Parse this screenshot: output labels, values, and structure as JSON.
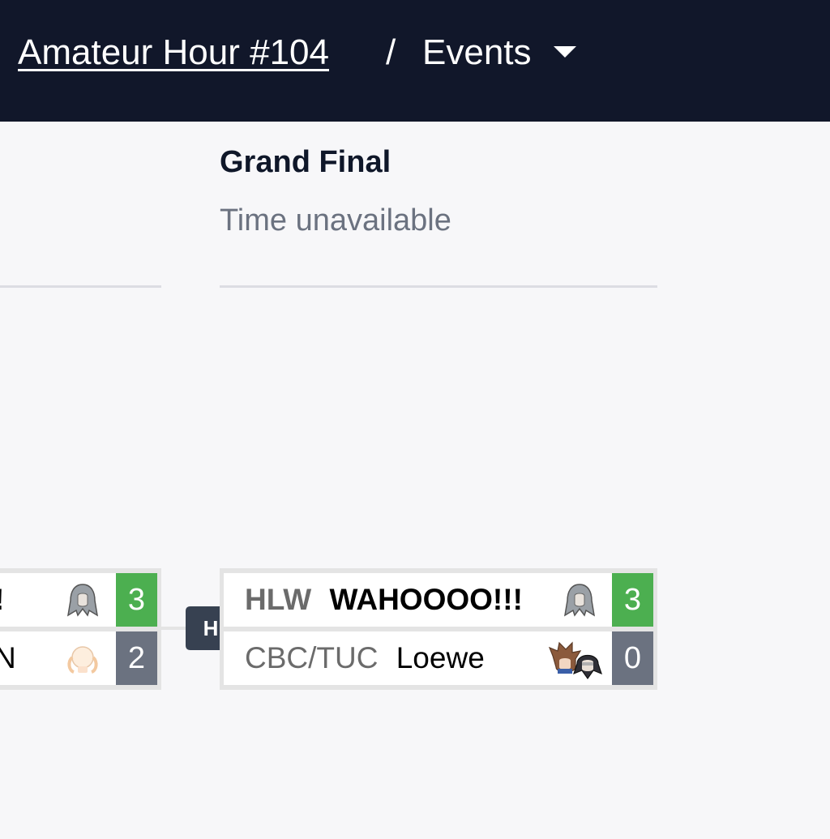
{
  "header": {
    "tournament_link": "Amateur Hour #104",
    "separator": "/",
    "events_label": "Events"
  },
  "round": {
    "title": "Grand Final",
    "time": "Time unavailable"
  },
  "left_match": {
    "top": {
      "name_fragment": "!",
      "score": "3",
      "character_icon": "sephiroth-icon"
    },
    "bottom": {
      "name_fragment": "N",
      "score": "2",
      "character_icon": "isabelle-icon"
    }
  },
  "badge": {
    "label": "H"
  },
  "grand_final": {
    "top": {
      "prefix": "HLW",
      "tag": "WAHOOOO!!!",
      "score": "3",
      "character_icon": "sephiroth-icon"
    },
    "bottom": {
      "prefix": "CBC/TUC",
      "tag": "Loewe",
      "score": "0",
      "character_icons": [
        "sora-icon",
        "joker-icon"
      ]
    }
  },
  "colors": {
    "header_bg": "#11172a",
    "win": "#4caf50",
    "lose": "#6b7280",
    "badge": "#374151"
  }
}
